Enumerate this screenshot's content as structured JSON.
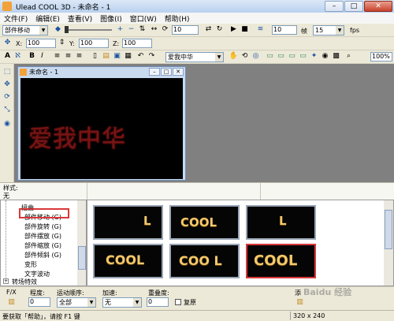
{
  "window": {
    "title": "Ulead COOL 3D - 未命名 - 1",
    "min": "–",
    "max": "□",
    "close": "✕"
  },
  "menu": [
    "文件(F)",
    "编辑(E)",
    "查看(V)",
    "图像(I)",
    "窗口(W)",
    "帮助(H)"
  ],
  "toolbar1": {
    "mode": "部件移动",
    "frame": "10",
    "fps_value": "10",
    "frames_label": "帧",
    "frames_value": "15",
    "fps_label": "fps"
  },
  "toolbar2": {
    "x_label": "X:",
    "x": "100",
    "y_label": "Y:",
    "y": "100",
    "z_label": "Z:",
    "z": "100"
  },
  "toolbar3": {
    "text_value": "爱我中华",
    "zoom": "100%"
  },
  "document": {
    "title": "未命名 - 1",
    "canvas_text": "爱我中华",
    "text_color": "#7a1414"
  },
  "style_panel": {
    "label": "样式:",
    "value": "无"
  },
  "tree": {
    "items": [
      {
        "label": "扭曲"
      },
      {
        "label": "部件移动 (G)"
      },
      {
        "label": "部件旋转 (G)"
      },
      {
        "label": "部件摆放 (G)"
      },
      {
        "label": "部件缩放 (G)"
      },
      {
        "label": "部件倾斜 (G)"
      },
      {
        "label": "变形"
      },
      {
        "label": "文字波动"
      },
      {
        "label": "转场特效"
      }
    ],
    "expander": "+"
  },
  "gallery": {
    "thumbs": [
      {
        "text": "L"
      },
      {
        "text": "COOL"
      },
      {
        "text": "L"
      },
      {
        "text": "COOL"
      },
      {
        "text": "COO L"
      },
      {
        "text": "COOL"
      }
    ],
    "accent": "#f4c86a"
  },
  "options": {
    "fx_label": "F/X",
    "degree_label": "程度:",
    "degree_value": "0",
    "order_label": "运动顺序:",
    "order_value": "全部",
    "accel_label": "加速:",
    "accel_value": "无",
    "repeat_label": "重叠度:",
    "repeat_value": "0",
    "reset_label": "复原",
    "extra_label": "添"
  },
  "status": {
    "text": "要获取「帮助」，请按 F1 键",
    "resolution": "320 x 240"
  },
  "watermark": "Baidu 经验"
}
